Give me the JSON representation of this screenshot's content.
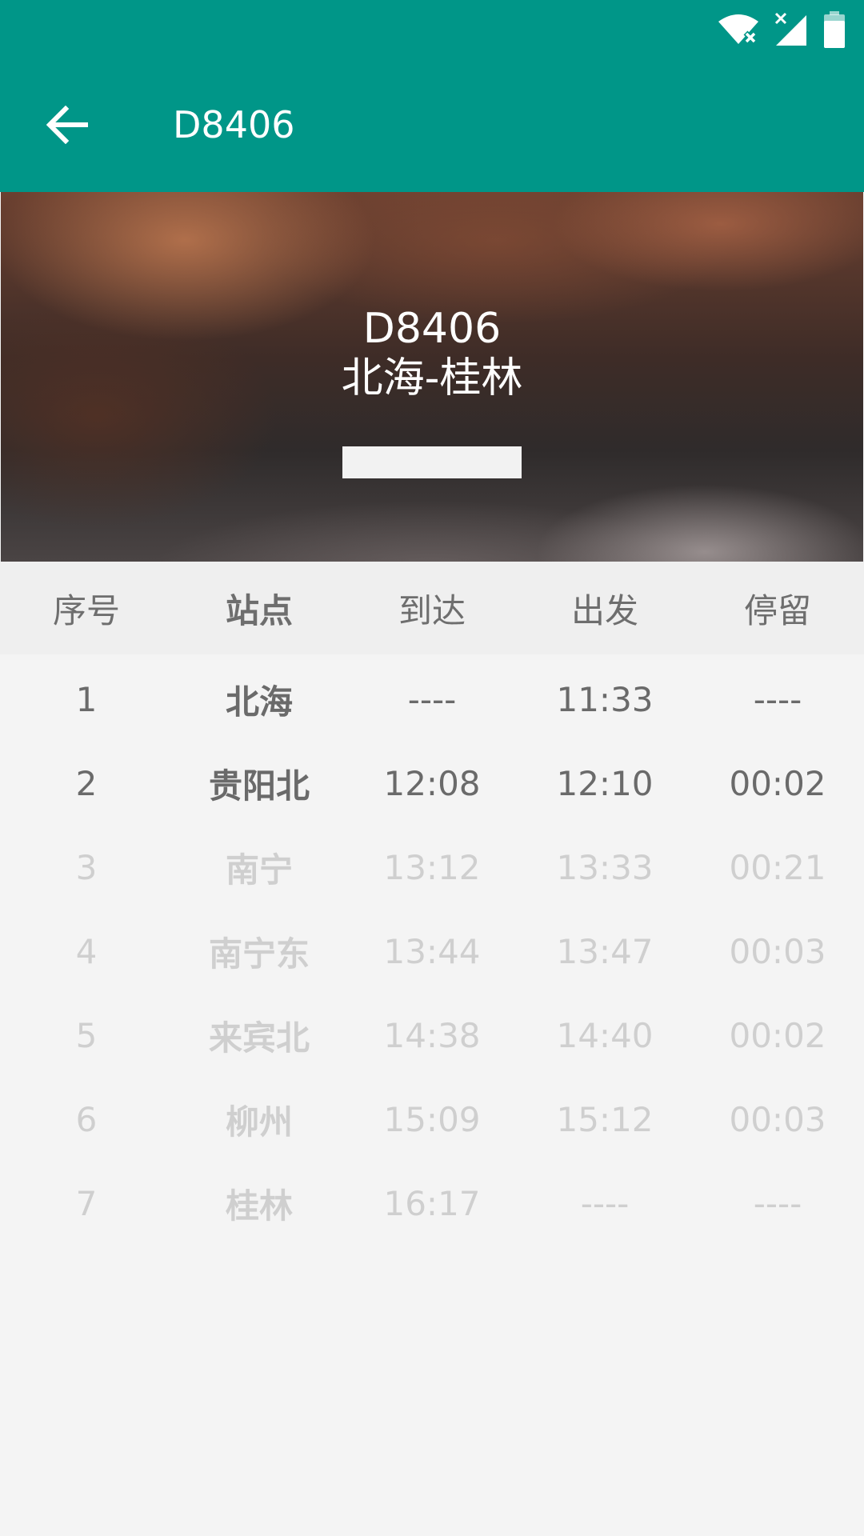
{
  "appbar": {
    "title": "D8406",
    "background_color": "#009688",
    "back_icon": "arrow-left-icon"
  },
  "status_bar": {
    "icons": [
      "wifi-off-icon",
      "signal-off-icon",
      "battery-icon"
    ]
  },
  "hero": {
    "train_no": "D8406",
    "route": "北海-桂林"
  },
  "table": {
    "headers": {
      "index": "序号",
      "station": "站点",
      "arrive": "到达",
      "depart": "出发",
      "stop": "停留"
    },
    "rows": [
      {
        "index": "1",
        "station": "北海",
        "arrive": "----",
        "depart": "11:33",
        "stop": "----",
        "state": "passed"
      },
      {
        "index": "2",
        "station": "贵阳北",
        "arrive": "12:08",
        "depart": "12:10",
        "stop": "00:02",
        "state": "current"
      },
      {
        "index": "3",
        "station": "南宁",
        "arrive": "13:12",
        "depart": "13:33",
        "stop": "00:21",
        "state": "upcoming"
      },
      {
        "index": "4",
        "station": "南宁东",
        "arrive": "13:44",
        "depart": "13:47",
        "stop": "00:03",
        "state": "upcoming"
      },
      {
        "index": "5",
        "station": "来宾北",
        "arrive": "14:38",
        "depart": "14:40",
        "stop": "00:02",
        "state": "upcoming"
      },
      {
        "index": "6",
        "station": "柳州",
        "arrive": "15:09",
        "depart": "15:12",
        "stop": "00:03",
        "state": "upcoming"
      },
      {
        "index": "7",
        "station": "桂林",
        "arrive": "16:17",
        "depart": "----",
        "stop": "----",
        "state": "upcoming"
      }
    ]
  }
}
